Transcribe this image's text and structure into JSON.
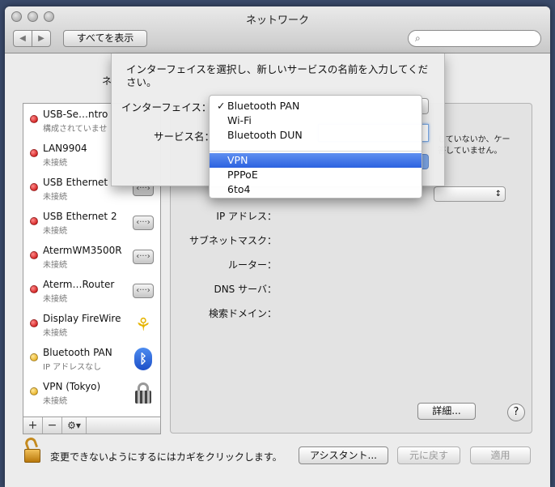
{
  "window": {
    "title": "ネットワーク"
  },
  "toolbar": {
    "back": "◀",
    "forward": "▶",
    "show_all": "すべてを表示",
    "search_placeholder": ""
  },
  "background_label": "ネ",
  "services": [
    {
      "name": "USB-Se…ntro",
      "status": "構成されていませ",
      "dot": "red",
      "icon": "network-icon"
    },
    {
      "name": "LAN9904",
      "status": "未接続",
      "dot": "red",
      "icon": "network-icon"
    },
    {
      "name": "USB Ethernet",
      "status": "未接続",
      "dot": "red",
      "icon": "network-icon"
    },
    {
      "name": "USB Ethernet 2",
      "status": "未接続",
      "dot": "red",
      "icon": "network-icon"
    },
    {
      "name": "AtermWM3500R",
      "status": "未接続",
      "dot": "red",
      "icon": "network-icon"
    },
    {
      "name": "Aterm…Router",
      "status": "未接続",
      "dot": "red",
      "icon": "network-icon"
    },
    {
      "name": "Display FireWire",
      "status": "未接続",
      "dot": "red",
      "icon": "firewire-icon"
    },
    {
      "name": "Bluetooth PAN",
      "status": "IP アドレスなし",
      "dot": "yellow",
      "icon": "bluetooth-icon"
    },
    {
      "name": "VPN (Tokyo)",
      "status": "未接続",
      "dot": "yellow",
      "icon": "vpn-lock-icon"
    }
  ],
  "list_bar": {
    "add": "+",
    "remove": "−",
    "gear": "⚙▾"
  },
  "detail": {
    "status_text": "していないか、ケー\n答していません。",
    "fields": {
      "ip": "IP アドレス：",
      "subnet": "サブネットマスク：",
      "router": "ルーター：",
      "dns": "DNS サーバ：",
      "search_domain": "検索ドメイン："
    },
    "popup_arrow": "↕",
    "advanced_button": "詳細...",
    "help_button": "?"
  },
  "footer": {
    "lock_text": "変更できないようにするにはカギをクリックします。",
    "assistant_button": "アシスタント...",
    "revert_button": "元に戻す",
    "apply_button": "適用"
  },
  "sheet": {
    "message": "インターフェイスを選択し、新しいサービスの名前を入力してください。",
    "interface_label": "インターフェイス：",
    "service_name_label": "サービス名："
  },
  "interface_menu": {
    "items": [
      "Bluetooth PAN",
      "Wi-Fi",
      "Bluetooth DUN",
      "VPN",
      "PPPoE",
      "6to4"
    ],
    "checked": "Bluetooth PAN",
    "highlighted": "VPN",
    "check_glyph": "✓"
  }
}
